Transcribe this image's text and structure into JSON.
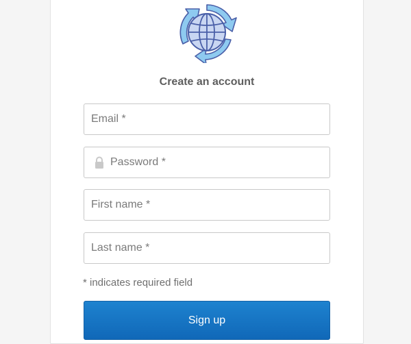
{
  "app": {
    "logo_icon": "globe-with-circular-arrows-icon"
  },
  "form": {
    "title": "Create an account",
    "fields": {
      "email": {
        "placeholder": "Email *",
        "value": ""
      },
      "password": {
        "placeholder": "Password *",
        "value": "",
        "icon": "lock-icon"
      },
      "first_name": {
        "placeholder": "First name *",
        "value": ""
      },
      "last_name": {
        "placeholder": "Last name *",
        "value": ""
      }
    },
    "required_note": "* indicates required field",
    "submit_label": "Sign up"
  },
  "colors": {
    "primary": "#1a78c6",
    "background": "#f5f5f5",
    "card": "#ffffff",
    "field_border": "#c8c8c8",
    "title_text": "#5e5e5e"
  }
}
